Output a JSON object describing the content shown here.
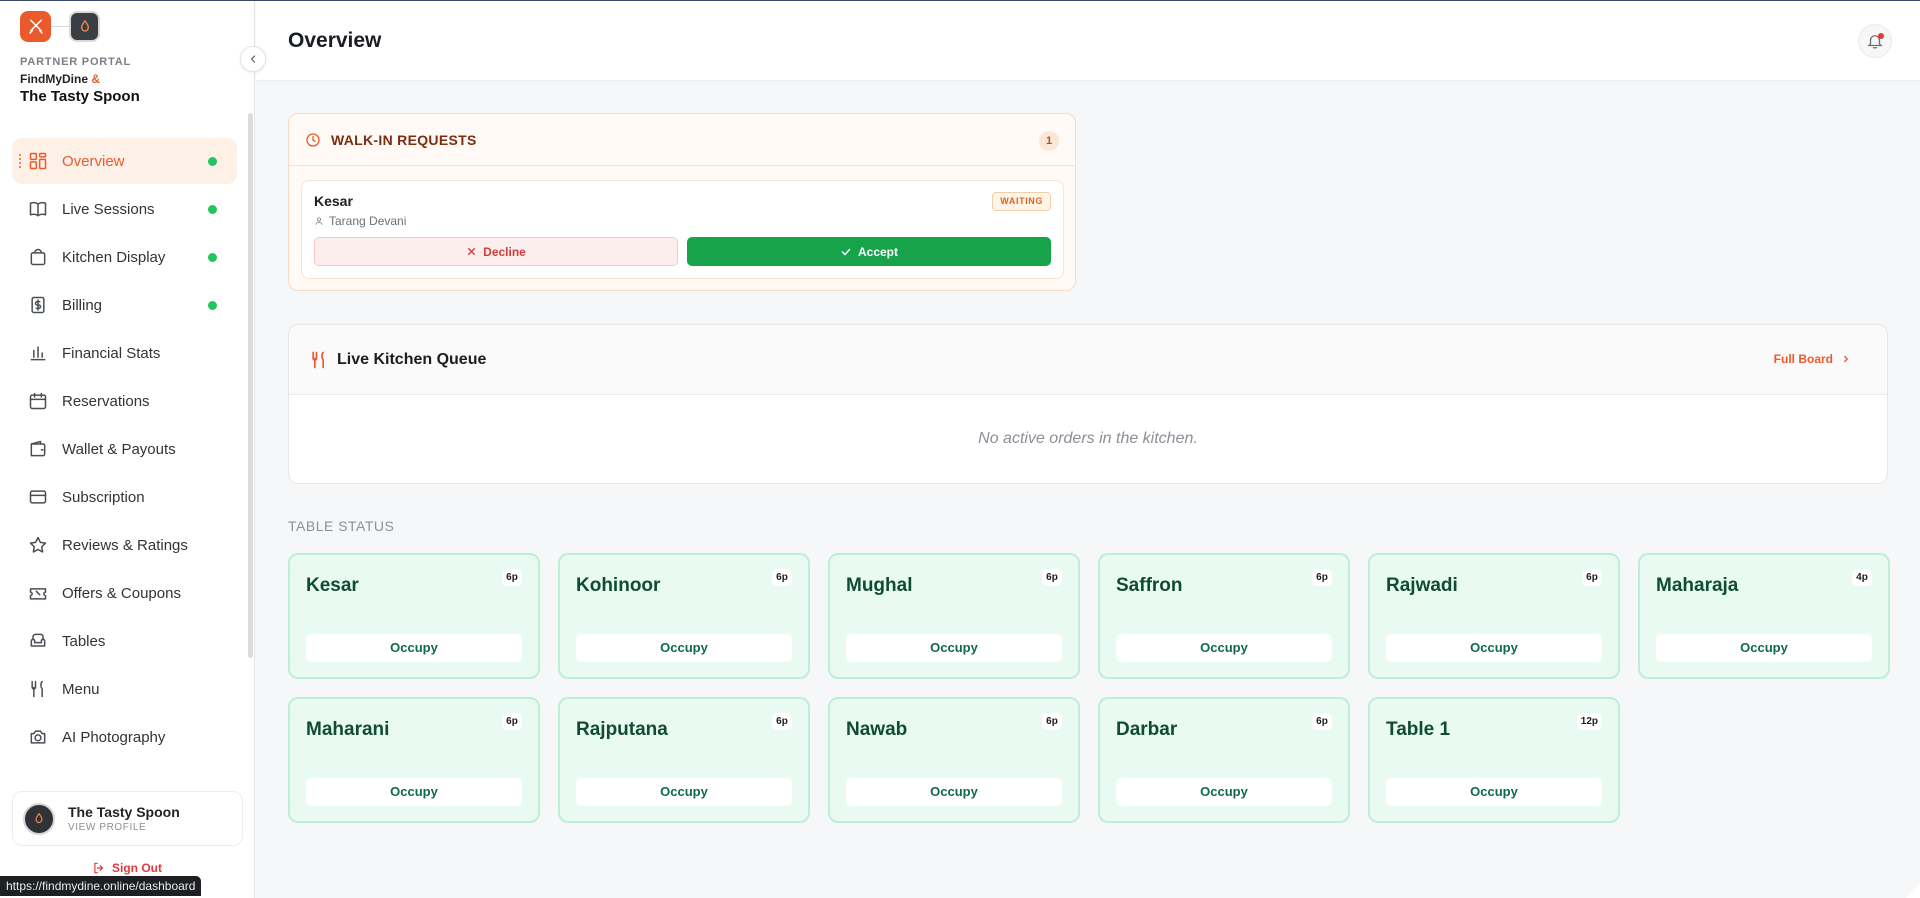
{
  "sidebar": {
    "portal_label": "PARTNER PORTAL",
    "brand_name": "FindMyDine",
    "brand_amp": "&",
    "restaurant_name": "The Tasty Spoon",
    "items": [
      {
        "label": "Overview",
        "icon": "grid-icon",
        "active": true,
        "dot": true
      },
      {
        "label": "Live Sessions",
        "icon": "book-icon",
        "active": false,
        "dot": true
      },
      {
        "label": "Kitchen Display",
        "icon": "bag-icon",
        "active": false,
        "dot": true
      },
      {
        "label": "Billing",
        "icon": "receipt-icon",
        "active": false,
        "dot": true
      },
      {
        "label": "Financial Stats",
        "icon": "bar-chart-icon",
        "active": false,
        "dot": false
      },
      {
        "label": "Reservations",
        "icon": "calendar-icon",
        "active": false,
        "dot": false
      },
      {
        "label": "Wallet & Payouts",
        "icon": "wallet-icon",
        "active": false,
        "dot": false
      },
      {
        "label": "Subscription",
        "icon": "credit-card-icon",
        "active": false,
        "dot": false
      },
      {
        "label": "Reviews & Ratings",
        "icon": "star-icon",
        "active": false,
        "dot": false
      },
      {
        "label": "Offers & Coupons",
        "icon": "ticket-icon",
        "active": false,
        "dot": false
      },
      {
        "label": "Tables",
        "icon": "armchair-icon",
        "active": false,
        "dot": false
      },
      {
        "label": "Menu",
        "icon": "utensils-icon",
        "active": false,
        "dot": false
      },
      {
        "label": "AI Photography",
        "icon": "camera-icon",
        "active": false,
        "dot": false
      }
    ],
    "profile": {
      "name": "The Tasty Spoon",
      "view": "VIEW PROFILE"
    },
    "sign_out": "Sign Out"
  },
  "status_url": "https://findmydine.online/dashboard",
  "header": {
    "title": "Overview"
  },
  "walkin": {
    "title": "WALK-IN REQUESTS",
    "count": "1",
    "request": {
      "table": "Kesar",
      "guest": "Tarang Devani",
      "status": "WAITING",
      "decline": "Decline",
      "accept": "Accept"
    }
  },
  "kitchen": {
    "title": "Live Kitchen Queue",
    "full_board": "Full Board",
    "empty": "No active orders in the kitchen."
  },
  "table_status": {
    "label": "TABLE STATUS",
    "tables": [
      {
        "name": "Kesar",
        "capacity": "6p",
        "action": "Occupy"
      },
      {
        "name": "Kohinoor",
        "capacity": "6p",
        "action": "Occupy"
      },
      {
        "name": "Mughal",
        "capacity": "6p",
        "action": "Occupy"
      },
      {
        "name": "Saffron",
        "capacity": "6p",
        "action": "Occupy"
      },
      {
        "name": "Rajwadi",
        "capacity": "6p",
        "action": "Occupy"
      },
      {
        "name": "Maharaja",
        "capacity": "4p",
        "action": "Occupy"
      },
      {
        "name": "Maharani",
        "capacity": "6p",
        "action": "Occupy"
      },
      {
        "name": "Rajputana",
        "capacity": "6p",
        "action": "Occupy"
      },
      {
        "name": "Nawab",
        "capacity": "6p",
        "action": "Occupy"
      },
      {
        "name": "Darbar",
        "capacity": "6p",
        "action": "Occupy"
      },
      {
        "name": "Table 1",
        "capacity": "12p",
        "action": "Occupy"
      }
    ]
  },
  "colors": {
    "accent": "#ea5a2c",
    "success": "#16a34a",
    "danger": "#d63a3a"
  }
}
